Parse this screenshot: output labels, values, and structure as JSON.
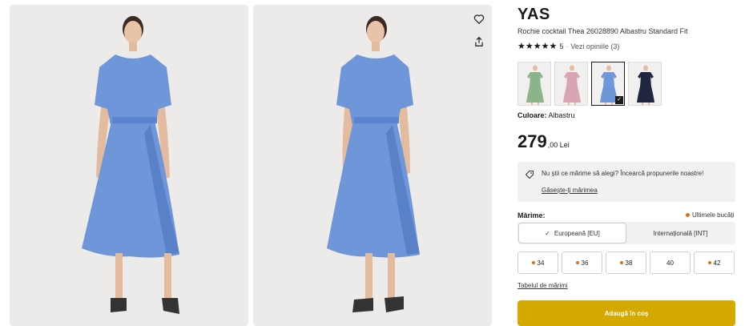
{
  "product": {
    "brand": "YAS",
    "title": "Rochie cocktail Thea 26028890 Albastru Standard Fit",
    "rating": {
      "stars": "★★★★★",
      "value": "5",
      "separator": "·",
      "reviews_link": "Vezi opiniile (3)"
    },
    "color": {
      "label": "Culoare:",
      "value": "Albastru",
      "swatches": [
        {
          "name": "green",
          "dress_color": "#8db38a",
          "selected": false
        },
        {
          "name": "pink",
          "dress_color": "#d9a5b0",
          "selected": false
        },
        {
          "name": "blue",
          "dress_color": "#6f96d8",
          "selected": true
        },
        {
          "name": "navy",
          "dress_color": "#1f2640",
          "selected": false
        }
      ],
      "check": "✓"
    },
    "price": {
      "main": "279",
      "decimals": ",00 Lei"
    }
  },
  "size_help": {
    "question": "Nu știi ce mărime să alegi? Încearcă propunerile noastre!",
    "link": "Găsește-ți mărimea"
  },
  "sizes": {
    "label": "Mărime:",
    "last_items": "Ultimele bucăți",
    "systems": {
      "eu": "Europeană [EU]",
      "int": "Internațională [INT]",
      "eu_tick": "✓"
    },
    "options": [
      {
        "label": "34",
        "low_stock": true
      },
      {
        "label": "36",
        "low_stock": true
      },
      {
        "label": "38",
        "low_stock": true
      },
      {
        "label": "40",
        "low_stock": false
      },
      {
        "label": "42",
        "low_stock": true
      }
    ],
    "table_link": "Tabelul de mărimi"
  },
  "cart": {
    "add_label": "Adaugă în coș"
  },
  "colors": {
    "dress": "#6f96d8",
    "dress_shade": "#4e77c2",
    "photo_bg": "#ecebe9",
    "accent": "#d5aa00",
    "low_stock": "#d9731a"
  }
}
